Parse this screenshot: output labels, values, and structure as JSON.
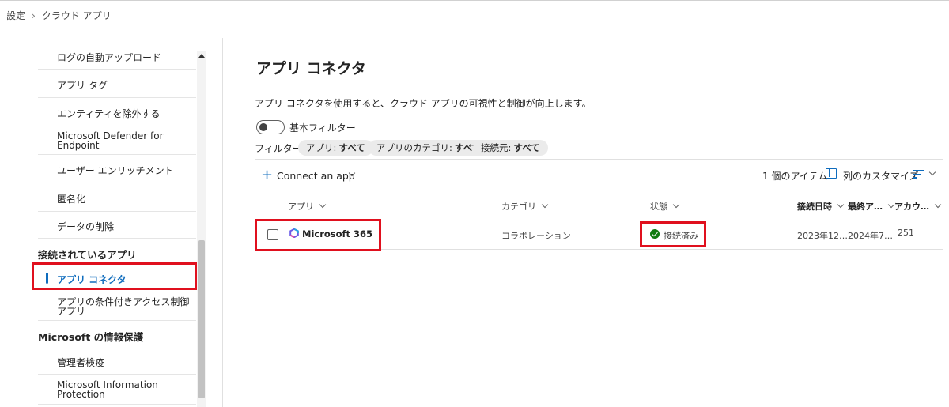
{
  "breadcrumb": {
    "item1": "設定",
    "separator": "›",
    "item2": "クラウド アプリ"
  },
  "sidebar": {
    "items": [
      {
        "label": "ログの自動アップロード"
      },
      {
        "label": "アプリ タグ"
      },
      {
        "label": "エンティティを除外する"
      },
      {
        "label": "Microsoft Defender for Endpoint"
      },
      {
        "label": "ユーザー エンリッチメント"
      },
      {
        "label": "匿名化"
      },
      {
        "label": "データの削除"
      }
    ],
    "group_connected": "接続されているアプリ",
    "connected_items": [
      {
        "label": "アプリ コネクタ",
        "active": true
      },
      {
        "label": "アプリの条件付きアクセス制御アプリ"
      }
    ],
    "group_infoprotect": "Microsoft の情報保護",
    "infoprotect_items": [
      {
        "label": "管理者検疫"
      },
      {
        "label": "Microsoft Information Protection"
      }
    ]
  },
  "main": {
    "title": "アプリ コネクタ",
    "description": "アプリ コネクタを使用すると、クラウド アプリの可視性と制御が向上します。",
    "basic_filter_label": "基本フィルター",
    "basic_filter_on": false,
    "filter_label": "フィルター:",
    "chips": [
      {
        "key": "アプリ:",
        "value": "すべて"
      },
      {
        "key": "アプリのカテゴリ:",
        "value": "すべて"
      },
      {
        "key": "接続元:",
        "value": "すべて"
      }
    ]
  },
  "toolbar": {
    "add_icon": "+",
    "connect_label": "Connect an app",
    "item_count": "1 個のアイテム",
    "customize_label": "列のカスタマイズ"
  },
  "table": {
    "headers": [
      "アプリ",
      "カテゴリ",
      "状態",
      "接続日時",
      "最終ア…",
      "アカウ…"
    ],
    "rows": [
      {
        "app": "Microsoft 365",
        "category": "コラボレーション",
        "status": "接続済み",
        "connected": "2023年12…",
        "last": "2024年7…",
        "accounts": "251"
      }
    ]
  },
  "colors": {
    "accent": "#0f6cbd",
    "highlight": "#e0101e",
    "status_ok": "#107c10"
  }
}
